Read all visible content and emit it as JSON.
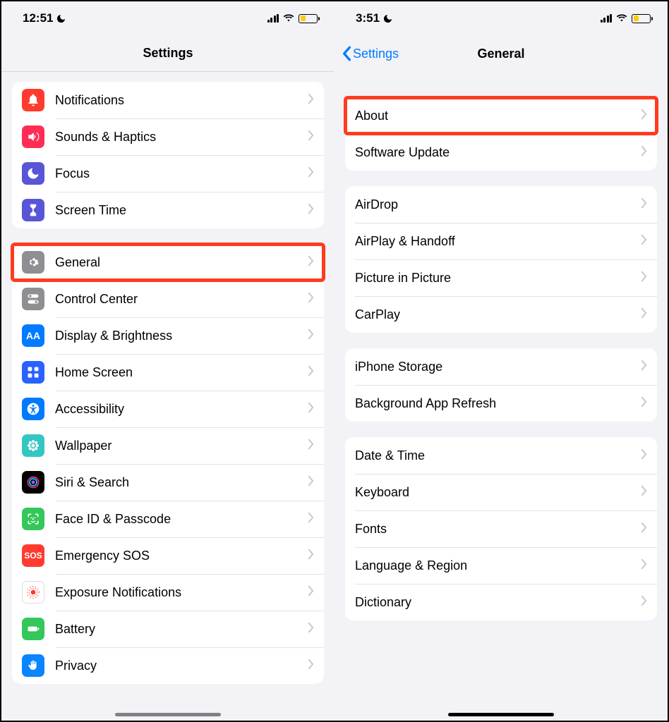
{
  "left": {
    "status": {
      "time": "12:51"
    },
    "title": "Settings",
    "group1": [
      {
        "label": "Notifications",
        "icon": "bell-icon",
        "bg": "bg-red"
      },
      {
        "label": "Sounds & Haptics",
        "icon": "speaker-icon",
        "bg": "bg-pink"
      },
      {
        "label": "Focus",
        "icon": "moon-icon",
        "bg": "bg-indigo"
      },
      {
        "label": "Screen Time",
        "icon": "hourglass-icon",
        "bg": "bg-indigo"
      }
    ],
    "group2": [
      {
        "label": "General",
        "icon": "gear-icon",
        "bg": "bg-grey",
        "highlight": true
      },
      {
        "label": "Control Center",
        "icon": "toggles-icon",
        "bg": "bg-grey"
      },
      {
        "label": "Display & Brightness",
        "icon": "aa-icon",
        "bg": "bg-blue"
      },
      {
        "label": "Home Screen",
        "icon": "grid-icon",
        "bg": "bg-deepblue"
      },
      {
        "label": "Accessibility",
        "icon": "accessibility-icon",
        "bg": "bg-blue"
      },
      {
        "label": "Wallpaper",
        "icon": "flower-icon",
        "bg": "bg-teal"
      },
      {
        "label": "Siri & Search",
        "icon": "siri-icon",
        "bg": "bg-black"
      },
      {
        "label": "Face ID & Passcode",
        "icon": "faceid-icon",
        "bg": "bg-green"
      },
      {
        "label": "Emergency SOS",
        "icon": "sos-icon",
        "bg": "bg-red"
      },
      {
        "label": "Exposure Notifications",
        "icon": "exposure-icon",
        "bg": "bg-white"
      },
      {
        "label": "Battery",
        "icon": "battery-icon",
        "bg": "bg-green"
      },
      {
        "label": "Privacy",
        "icon": "hand-icon",
        "bg": "bg-privacy"
      }
    ]
  },
  "right": {
    "status": {
      "time": "3:51"
    },
    "back": "Settings",
    "title": "General",
    "group1": [
      {
        "label": "About",
        "highlight": true
      },
      {
        "label": "Software Update"
      }
    ],
    "group2": [
      {
        "label": "AirDrop"
      },
      {
        "label": "AirPlay & Handoff"
      },
      {
        "label": "Picture in Picture"
      },
      {
        "label": "CarPlay"
      }
    ],
    "group3": [
      {
        "label": "iPhone Storage"
      },
      {
        "label": "Background App Refresh"
      }
    ],
    "group4": [
      {
        "label": "Date & Time"
      },
      {
        "label": "Keyboard"
      },
      {
        "label": "Fonts"
      },
      {
        "label": "Language & Region"
      },
      {
        "label": "Dictionary"
      }
    ]
  }
}
